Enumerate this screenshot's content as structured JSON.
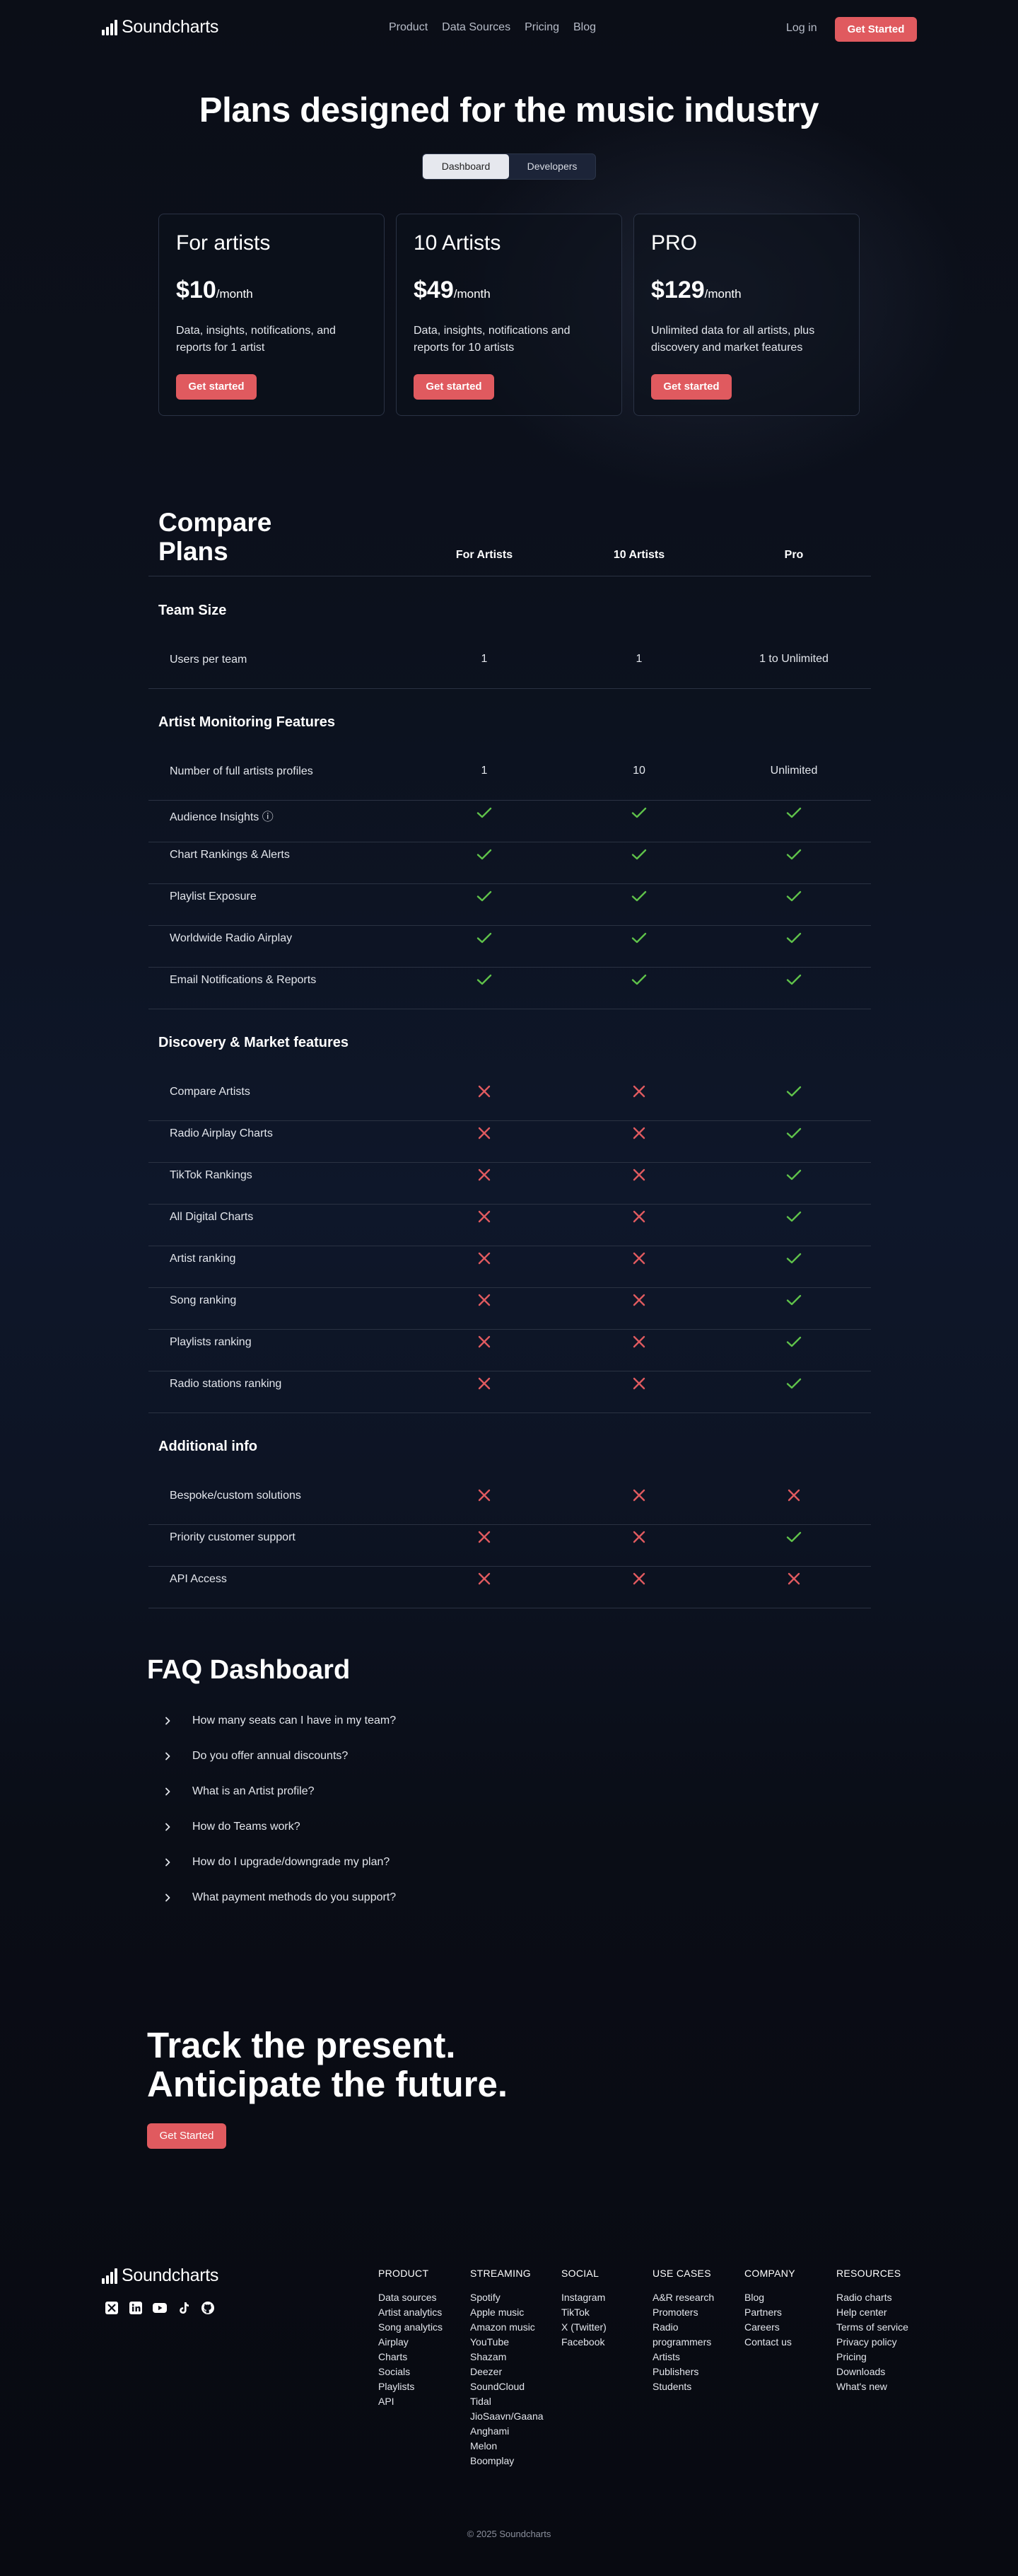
{
  "nav": {
    "logo_text": "Soundcharts",
    "links": [
      "Product",
      "Data Sources",
      "Pricing",
      "Blog"
    ],
    "login": "Log in",
    "cta": "Get Started"
  },
  "hero": {
    "title": "Plans designed for the music industry",
    "toggle": [
      "Dashboard",
      "Developers"
    ]
  },
  "plans": [
    {
      "name": "For artists",
      "price": "$10",
      "period": "/month",
      "description": "Data, insights, notifications, and reports for 1 artist",
      "cta": "Get started"
    },
    {
      "name": "10 Artists",
      "price": "$49",
      "period": "/month",
      "description": "Data, insights, notifications and reports for 10 artists",
      "cta": "Get started"
    },
    {
      "name": "PRO",
      "price": "$129",
      "period": "/month",
      "description": "Unlimited data for all artists, plus discovery and market features",
      "cta": "Get started"
    }
  ],
  "compare": {
    "title": "Compare Plans",
    "columns": [
      "For Artists",
      "10 Artists",
      "Pro"
    ],
    "sections": [
      {
        "title": "Team Size",
        "rows": [
          {
            "label": "Users per team",
            "values": [
              "1",
              "1",
              "1 to Unlimited"
            ]
          }
        ]
      },
      {
        "title": "Artist Monitoring Features",
        "rows": [
          {
            "label": "Number of full artists profiles",
            "values": [
              "1",
              "10",
              "Unlimited"
            ]
          },
          {
            "label": "Audience Insights ⓘ",
            "values": [
              "check",
              "check",
              "check"
            ]
          },
          {
            "label": "Chart Rankings & Alerts",
            "values": [
              "check",
              "check",
              "check"
            ]
          },
          {
            "label": "Playlist Exposure",
            "values": [
              "check",
              "check",
              "check"
            ]
          },
          {
            "label": "Worldwide Radio Airplay",
            "values": [
              "check",
              "check",
              "check"
            ]
          },
          {
            "label": "Email Notifications & Reports",
            "values": [
              "check",
              "check",
              "check"
            ]
          }
        ]
      },
      {
        "title": "Discovery & Market features",
        "rows": [
          {
            "label": "Compare Artists",
            "values": [
              "cross",
              "cross",
              "check"
            ]
          },
          {
            "label": "Radio Airplay Charts",
            "values": [
              "cross",
              "cross",
              "check"
            ]
          },
          {
            "label": "TikTok Rankings",
            "values": [
              "cross",
              "cross",
              "check"
            ]
          },
          {
            "label": "All Digital Charts",
            "values": [
              "cross",
              "cross",
              "check"
            ]
          },
          {
            "label": "Artist ranking",
            "values": [
              "cross",
              "cross",
              "check"
            ]
          },
          {
            "label": "Song ranking",
            "values": [
              "cross",
              "cross",
              "check"
            ]
          },
          {
            "label": "Playlists ranking",
            "values": [
              "cross",
              "cross",
              "check"
            ]
          },
          {
            "label": "Radio stations ranking",
            "values": [
              "cross",
              "cross",
              "check"
            ]
          }
        ]
      },
      {
        "title": "Additional info",
        "rows": [
          {
            "label": "Bespoke/custom solutions",
            "values": [
              "cross",
              "cross",
              "cross"
            ]
          },
          {
            "label": "Priority customer support",
            "values": [
              "cross",
              "cross",
              "check"
            ]
          },
          {
            "label": "API Access",
            "values": [
              "cross",
              "cross",
              "cross"
            ]
          }
        ]
      }
    ]
  },
  "faq": {
    "title": "FAQ Dashboard",
    "items": [
      "How many seats can I have in my team?",
      "Do you offer annual discounts?",
      "What is an Artist profile?",
      "How do Teams work?",
      "How do I upgrade/downgrade my plan?",
      "What payment methods do you support?"
    ]
  },
  "cta": {
    "line1": "Track the present.",
    "line2": "Anticipate the future.",
    "button": "Get Started"
  },
  "footer": {
    "logo_text": "Soundcharts",
    "social_icons": [
      "x-icon",
      "linkedin-icon",
      "youtube-icon",
      "tiktok-icon",
      "github-icon"
    ],
    "columns": [
      {
        "heading": "PRODUCT",
        "links": [
          "Data sources",
          "Artist analytics",
          "Song analytics",
          "Airplay",
          "Charts",
          "Socials",
          "Playlists",
          "API"
        ]
      },
      {
        "heading": "STREAMING",
        "links": [
          "Spotify",
          "Apple music",
          "Amazon music",
          "YouTube",
          "Shazam",
          "Deezer",
          "SoundCloud",
          "Tidal",
          "JioSaavn/Gaana",
          "Anghami",
          "Melon",
          "Boomplay"
        ]
      },
      {
        "heading": "SOCIAL",
        "links": [
          "Instagram",
          "TikTok",
          "X (Twitter)",
          "Facebook"
        ]
      },
      {
        "heading": "USE CASES",
        "links": [
          "A&R research",
          "Promoters",
          "Radio programmers",
          "Artists",
          "Publishers",
          "Students"
        ]
      },
      {
        "heading": "COMPANY",
        "links": [
          "Blog",
          "Partners",
          "Careers",
          "Contact us"
        ]
      },
      {
        "heading": "RESOURCES",
        "links": [
          "Radio charts",
          "Help center",
          "Terms of service",
          "Privacy policy",
          "Pricing",
          "Downloads",
          "What's new"
        ]
      }
    ],
    "copyright": "© 2025 Soundcharts"
  },
  "colors": {
    "accent": "#e05a5f",
    "check": "#5fc24a",
    "cross": "#e05a5f"
  }
}
